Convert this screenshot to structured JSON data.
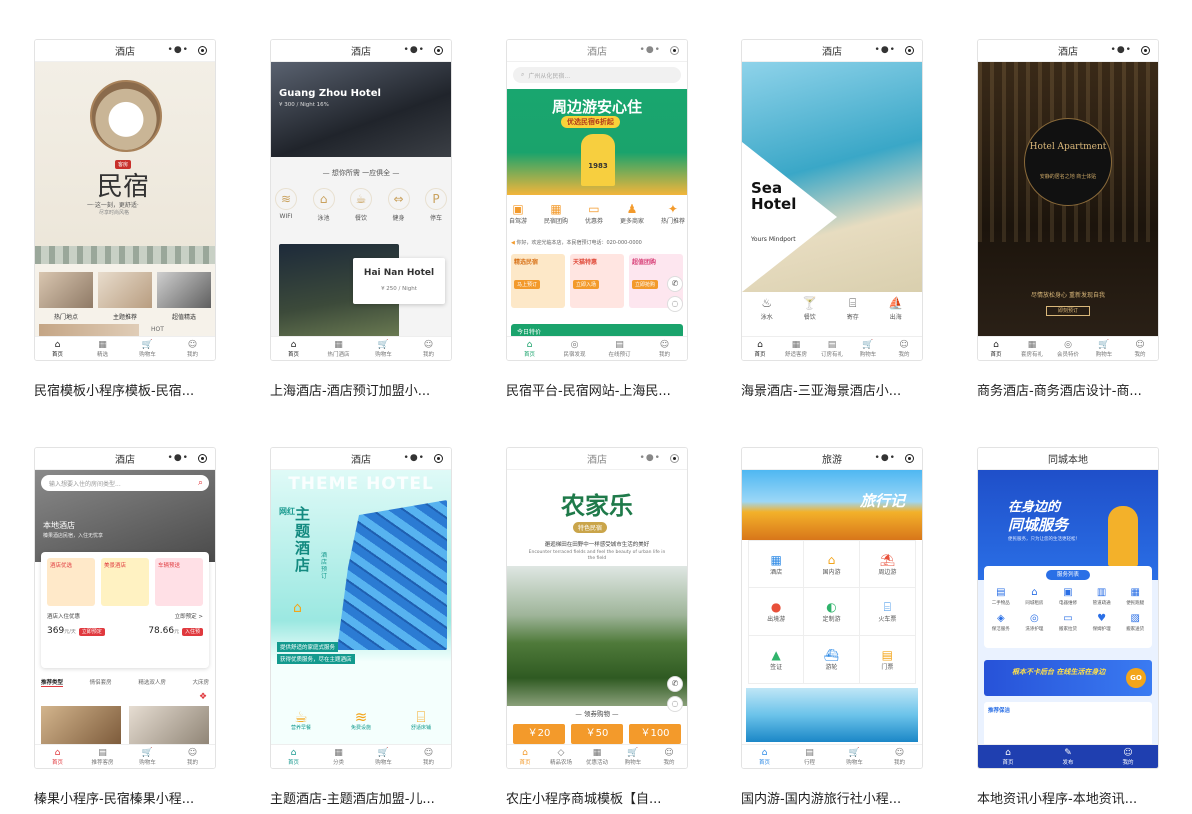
{
  "cards": [
    {
      "title": "酒店",
      "caption": "民宿模板小程序模板-民宿...",
      "hero": {
        "badge": "客房",
        "big": "民宿",
        "sub": "一·这一刻，更舒适·",
        "small": "尽享时尚风格"
      },
      "rooms": [
        "热门地点",
        "主题推荐",
        "超值精选"
      ],
      "bottom_text": "HOT",
      "tabs": [
        {
          "icon": "⌂",
          "label": "首页"
        },
        {
          "icon": "▦",
          "label": "精选"
        },
        {
          "icon": "🛒",
          "label": "购物车"
        },
        {
          "icon": "☺",
          "label": "我的"
        }
      ]
    },
    {
      "title": "酒店",
      "caption": "上海酒店-酒店预订加盟小...",
      "hero": {
        "name": "Guang Zhou Hotel",
        "price": "¥ 300 / Night  16%"
      },
      "section": "— 想你所需 一应俱全 —",
      "facilities": [
        {
          "icon": "≋",
          "label": "WIFI"
        },
        {
          "icon": "⌂",
          "label": "泳池"
        },
        {
          "icon": "☕",
          "label": "餐饮"
        },
        {
          "icon": "⇔",
          "label": "健身"
        },
        {
          "icon": "P",
          "label": "停车"
        }
      ],
      "hotel_name": "Hai Nan Hotel",
      "hotel_price": "¥ 250 / Night",
      "tabs": [
        {
          "icon": "⌂",
          "label": "首页"
        },
        {
          "icon": "▦",
          "label": "热门酒店"
        },
        {
          "icon": "🛒",
          "label": "购物车"
        },
        {
          "icon": "☺",
          "label": "我的"
        }
      ]
    },
    {
      "title": "酒店",
      "caption": "民宿平台-民宿网站-上海民...",
      "search_placeholder": "广州从化民宿...",
      "banner_title": "周边游安心住",
      "banner_sub": "优选民宿6折起",
      "banner_num": "1983",
      "cats": [
        "自驾游",
        "民宿团购",
        "优惠券",
        "更多商家",
        "热门推荐"
      ],
      "notice": "你好，欢迎光临本店，本民宿预订电话：020-000-0000",
      "promos": [
        {
          "title": "精选民宿",
          "btn": "马上预订"
        },
        {
          "title": "天猫特惠",
          "btn": "立即入场"
        },
        {
          "title": "超值团购",
          "btn": "立即抢购"
        }
      ],
      "strip": "今日特价",
      "tabs": [
        {
          "icon": "⌂",
          "label": "首页"
        },
        {
          "icon": "◎",
          "label": "民宿发现"
        },
        {
          "icon": "▤",
          "label": "在线预订"
        },
        {
          "icon": "☺",
          "label": "我的"
        }
      ]
    },
    {
      "title": "酒店",
      "caption": "海景酒店-三亚海景酒店小...",
      "brand": "Sea Hotel",
      "brand_sub": "Yours Mindport",
      "icons": [
        {
          "icon": "♨",
          "label": "泳水"
        },
        {
          "icon": "🍸",
          "label": "餐饮"
        },
        {
          "icon": "⌸",
          "label": "寄存"
        },
        {
          "icon": "⛵",
          "label": "出海"
        }
      ],
      "tabs": [
        {
          "icon": "⌂",
          "label": "首页"
        },
        {
          "icon": "▦",
          "label": "舒适客房"
        },
        {
          "icon": "▤",
          "label": "订房有礼"
        },
        {
          "icon": "🛒",
          "label": "购物车"
        },
        {
          "icon": "☺",
          "label": "我的"
        }
      ]
    },
    {
      "title": "酒店",
      "caption": "商务酒店-商务酒店设计-商...",
      "sign": "Hotel Apartment",
      "sign_sub": "安静的居名之地 商士体贴",
      "slogan": "尽情放松身心 重新发现自我",
      "btn": "即刻预订",
      "tabs": [
        {
          "icon": "⌂",
          "label": "首页"
        },
        {
          "icon": "▦",
          "label": "套房有礼"
        },
        {
          "icon": "◎",
          "label": "会员特价"
        },
        {
          "icon": "🛒",
          "label": "购物车"
        },
        {
          "icon": "☺",
          "label": "我的"
        }
      ]
    },
    {
      "title": "酒店",
      "caption": "榛果小程序-民宿榛果小程...",
      "search_placeholder": "输入想要入住的房间类型...",
      "shop": "本地酒店",
      "shop_sub": "榛果酒店民宿，入住无忧享",
      "promos": [
        {
          "label": "酒店优选"
        },
        {
          "label": "美景酒店"
        },
        {
          "label": "车辆预送"
        }
      ],
      "row_a": "酒店入住优惠",
      "row_b": "立即预定 >",
      "price1": "369",
      "price1_unit": "元/天",
      "price1_btn": "立即预定",
      "price2": "78.66",
      "price2_unit": "元",
      "price2_btn": "入住预",
      "filters": [
        "推荐类型",
        "情侣套房",
        "精选双人房",
        "大床房"
      ],
      "tabs": [
        {
          "icon": "⌂",
          "label": "首页"
        },
        {
          "icon": "▤",
          "label": "推荐客房"
        },
        {
          "icon": "🛒",
          "label": "购物车"
        },
        {
          "icon": "☺",
          "label": "我的"
        }
      ]
    },
    {
      "title": "酒店",
      "caption": "主题酒店-主题酒店加盟-儿...",
      "bg_text": "THEME HOTEL",
      "tag": "网红",
      "big": "主题酒店",
      "side": "酒店预订",
      "lines": [
        "提供舒适的家庭式服务",
        "获得优质服务，尽在主题酒店"
      ],
      "icons": [
        {
          "icon": "☕",
          "label": "营养早餐"
        },
        {
          "icon": "≋",
          "label": "免费设施"
        },
        {
          "icon": "⌸",
          "label": "舒适床铺"
        }
      ],
      "tabs": [
        {
          "icon": "⌂",
          "label": "首页"
        },
        {
          "icon": "▦",
          "label": "分类"
        },
        {
          "icon": "🛒",
          "label": "购物车"
        },
        {
          "icon": "☺",
          "label": "我的"
        }
      ]
    },
    {
      "title": "酒店",
      "caption": "农庄小程序商城模板【自...",
      "big": "农家乐",
      "tag": "特色民宿",
      "desc1": "邂逅梯田在田野中一样感受城市生活的美好",
      "desc2": "Encounter terraced fields and feel the beauty of urban life in the field",
      "section": "— 领券购物 —",
      "coupons": [
        "￥20",
        "￥50",
        "￥100"
      ],
      "tabs": [
        {
          "icon": "⌂",
          "label": "首页"
        },
        {
          "icon": "◇",
          "label": "精品农场"
        },
        {
          "icon": "▦",
          "label": "优惠活动"
        },
        {
          "icon": "🛒",
          "label": "购物车"
        },
        {
          "icon": "☺",
          "label": "我的"
        }
      ]
    },
    {
      "title": "旅游",
      "caption": "国内游-国内游旅行社小程...",
      "banner_text": "旅行记",
      "grid": [
        {
          "icon": "▦",
          "label": "酒店"
        },
        {
          "icon": "⌂",
          "label": "国内游"
        },
        {
          "icon": "⛱",
          "label": "周边游"
        },
        {
          "icon": "●",
          "label": "出境游"
        },
        {
          "icon": "◐",
          "label": "定制游"
        },
        {
          "icon": "⌸",
          "label": "火车票"
        },
        {
          "icon": "▲",
          "label": "签证"
        },
        {
          "icon": "⛴",
          "label": "游轮"
        },
        {
          "icon": "▤",
          "label": "门票"
        }
      ],
      "tabs": [
        {
          "icon": "⌂",
          "label": "首页"
        },
        {
          "icon": "▤",
          "label": "行程"
        },
        {
          "icon": "🛒",
          "label": "购物车"
        },
        {
          "icon": "☺",
          "label": "我的"
        }
      ]
    },
    {
      "title": "同城本地",
      "caption": "本地资讯小程序-本地资讯...",
      "banner_title1": "在身边的",
      "banner_title2": "同城服务",
      "banner_sub": "便民服务，只为让您的生活更轻松！",
      "service_title": "服务列表",
      "services": [
        "二手物品",
        "同城租房",
        "电器维修",
        "管道疏通",
        "便民跑腿",
        "保洁服务",
        "洗涤护理",
        "搬家拉货",
        "保姆护理",
        "搬家送货"
      ],
      "promo": "根本不卡后台 在线生活在身边",
      "promo_btn": "GO",
      "section": "推荐保洁",
      "tabs": [
        {
          "icon": "⌂",
          "label": "首页"
        },
        {
          "icon": "✎",
          "label": "发布"
        },
        {
          "icon": "☺",
          "label": "我的"
        }
      ]
    }
  ],
  "colors": {
    "green": "#1aa36c",
    "orange": "#f39a2b",
    "blue": "#1f5fd6",
    "teal": "#3fd1c6"
  }
}
